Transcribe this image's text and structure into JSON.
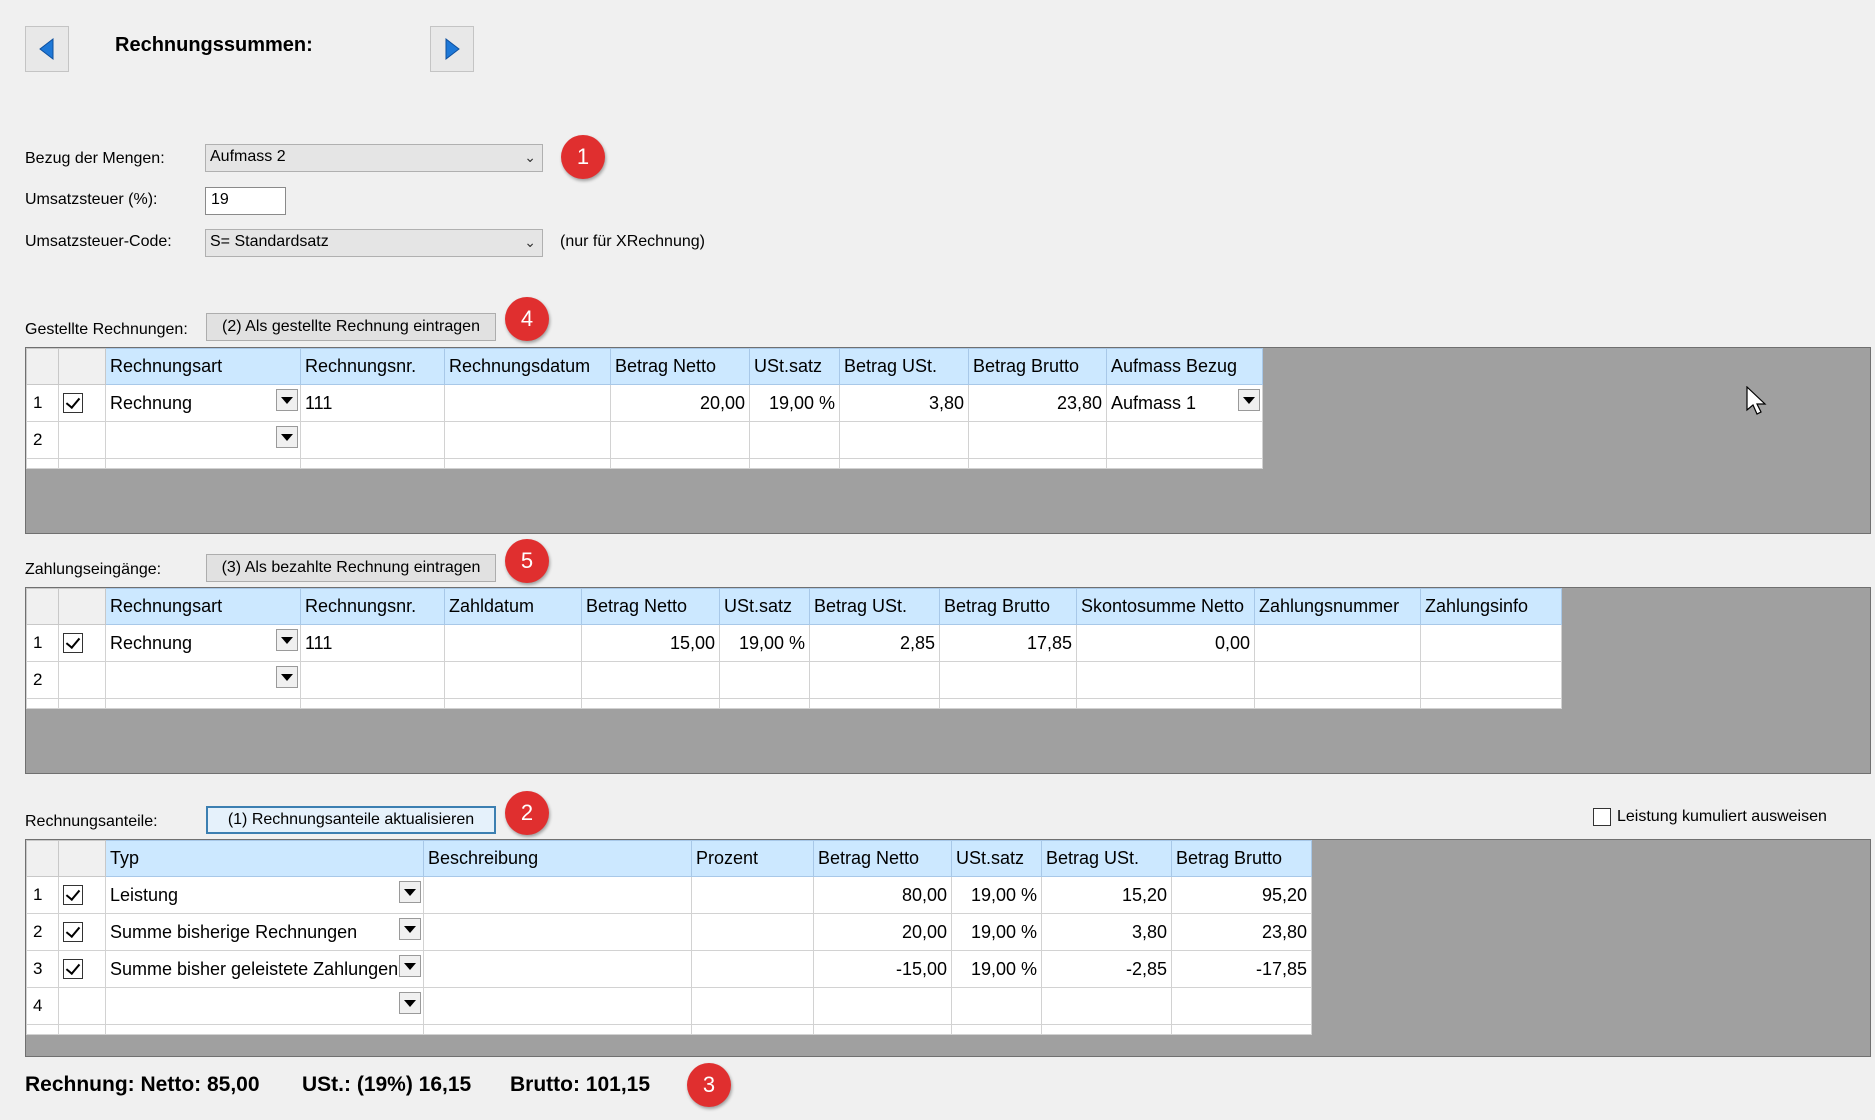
{
  "header": {
    "title": "Rechnungssummen:"
  },
  "form": {
    "bezug_label": "Bezug der Mengen:",
    "bezug_value": "Aufmass 2",
    "ust_label": "Umsatzsteuer (%):",
    "ust_value": "19",
    "ustcode_label": "Umsatzsteuer-Code:",
    "ustcode_value": "S= Standardsatz",
    "ustcode_note": "(nur für XRechnung)"
  },
  "badges": [
    "1",
    "4",
    "5",
    "2",
    "3"
  ],
  "gestellte": {
    "label": "Gestellte Rechnungen:",
    "button": "(2) Als gestellte Rechnung eintragen",
    "columns": [
      "Rechnungsart",
      "Rechnungsnr.",
      "Rechnungsdatum",
      "Betrag Netto",
      "USt.satz",
      "Betrag USt.",
      "Betrag Brutto",
      "Aufmass Bezug"
    ],
    "rows": [
      {
        "num": "1",
        "checked": true,
        "cells": [
          "Rechnung",
          "111",
          "",
          "20,00",
          "19,00 %",
          "3,80",
          "23,80",
          "Aufmass 1"
        ]
      },
      {
        "num": "2",
        "checked": false,
        "cells": [
          "",
          "",
          "",
          "",
          "",
          "",
          "",
          ""
        ]
      }
    ]
  },
  "zahlungen": {
    "label": "Zahlungseingänge:",
    "button": "(3) Als bezahlte Rechnung eintragen",
    "columns": [
      "Rechnungsart",
      "Rechnungsnr.",
      "Zahldatum",
      "Betrag Netto",
      "USt.satz",
      "Betrag USt.",
      "Betrag Brutto",
      "Skontosumme Netto",
      "Zahlungsnummer",
      "Zahlungsinfo"
    ],
    "rows": [
      {
        "num": "1",
        "checked": true,
        "cells": [
          "Rechnung",
          "111",
          "",
          "15,00",
          "19,00 %",
          "2,85",
          "17,85",
          "0,00",
          "",
          ""
        ]
      },
      {
        "num": "2",
        "checked": false,
        "cells": [
          "",
          "",
          "",
          "",
          "",
          "",
          "",
          "",
          "",
          ""
        ]
      }
    ]
  },
  "anteile": {
    "label": "Rechnungsanteile:",
    "button": "(1) Rechnungsanteile aktualisieren",
    "kumuliert_label": "Leistung kumuliert ausweisen",
    "columns": [
      "Typ",
      "Beschreibung",
      "Prozent",
      "Betrag Netto",
      "USt.satz",
      "Betrag USt.",
      "Betrag Brutto"
    ],
    "rows": [
      {
        "num": "1",
        "checked": true,
        "cells": [
          "Leistung",
          "",
          "",
          "80,00",
          "19,00 %",
          "15,20",
          "95,20"
        ]
      },
      {
        "num": "2",
        "checked": true,
        "cells": [
          "Summe bisherige Rechnungen",
          "",
          "",
          "20,00",
          "19,00 %",
          "3,80",
          "23,80"
        ]
      },
      {
        "num": "3",
        "checked": true,
        "cells": [
          "Summe bisher geleistete Zahlungen",
          "",
          "",
          "-15,00",
          "19,00 %",
          "-2,85",
          "-17,85"
        ]
      },
      {
        "num": "4",
        "checked": false,
        "cells": [
          "",
          "",
          "",
          "",
          "",
          "",
          ""
        ]
      }
    ]
  },
  "summary": {
    "netto": "Rechnung: Netto: 85,00",
    "ust": "USt.: (19%) 16,15",
    "brutto": "Brutto: 101,15"
  },
  "colors": {
    "header_bg": "#cce8ff",
    "grid_bg": "#a0a0a0",
    "badge": "#e02f2f"
  }
}
